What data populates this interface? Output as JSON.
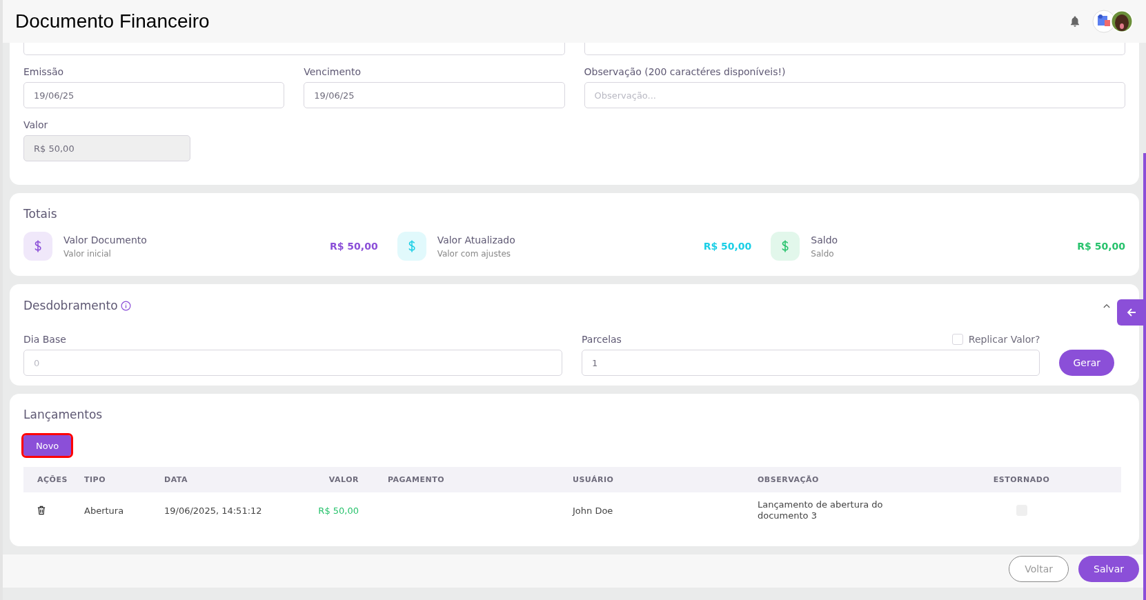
{
  "header": {
    "title": "Documento Financeiro"
  },
  "document": {
    "fields": [
      {
        "label": "Emissão",
        "value": "19/06/25",
        "disabled": false
      },
      {
        "label": "Vencimento",
        "value": "19/06/25",
        "disabled": false
      },
      {
        "label": "Observação (200 caractéres disponíveis!)",
        "placeholder": "Observação...",
        "disabled": false
      },
      {
        "label": "Valor",
        "value": "R$ 50,00",
        "disabled": true
      }
    ]
  },
  "totals": {
    "title": "Totais",
    "items": [
      {
        "title": "Valor Documento",
        "subtitle": "Valor inicial",
        "value": "R$ 50,00",
        "color": "#8b4fd8"
      },
      {
        "title": "Valor Atualizado",
        "subtitle": "Valor com ajustes",
        "value": "R$ 50,00",
        "color": "#1ccfe6"
      },
      {
        "title": "Saldo",
        "subtitle": "Saldo",
        "value": "R$ 50,00",
        "color": "#27c26c"
      }
    ]
  },
  "split": {
    "title": "Desdobramento",
    "expanded": true,
    "base_day": {
      "label": "Dia Base",
      "placeholder": "0"
    },
    "installments": {
      "label": "Parcelas",
      "value": "1"
    },
    "replicate": {
      "label": "Replicar Valor?",
      "checked": false
    },
    "generate_button": "Gerar"
  },
  "entries": {
    "title": "Lançamentos",
    "new_button": {
      "label": "Novo",
      "highlighted": true
    },
    "columns": [
      "AÇÕES",
      "TIPO",
      "DATA",
      "VALOR",
      "PAGAMENTO",
      "USUÁRIO",
      "OBSERVAÇÃO",
      "ESTORNADO"
    ],
    "rows": [
      {
        "type": "Abertura",
        "date": "19/06/2025, 14:51:12",
        "value": "R$ 50,00",
        "user": "John Doe",
        "note": "Lançamento de abertura do documento 3",
        "reversed": false
      }
    ]
  },
  "footer": {
    "buttons": [
      {
        "label": "Voltar",
        "kind": "outline"
      },
      {
        "label": "Salvar",
        "kind": "primary"
      }
    ]
  }
}
